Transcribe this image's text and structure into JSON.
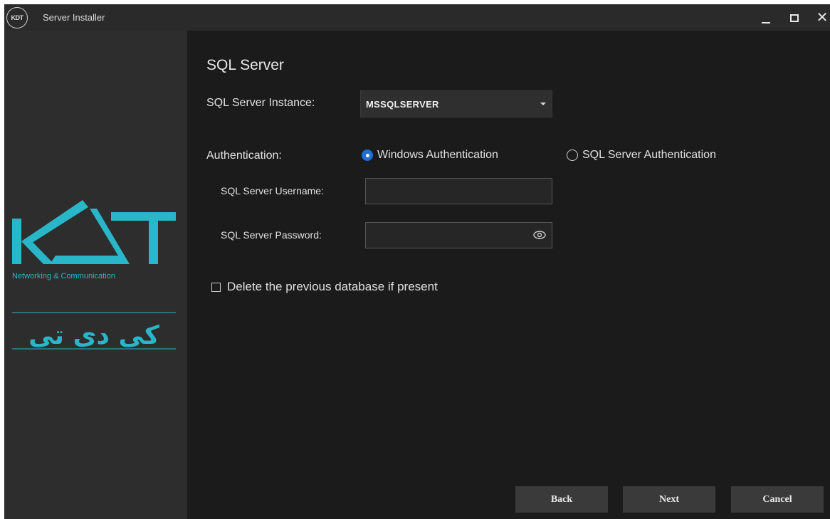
{
  "window": {
    "title": "Server Installer",
    "logo_text": "KDT"
  },
  "sidebar": {
    "brand": "KDT",
    "tagline": "Networking & Communication",
    "brand_farsi": "کی دی تی",
    "accent": "#29b6c8"
  },
  "main": {
    "section_title": "SQL Server",
    "instance": {
      "label": "SQL Server Instance:",
      "value": "MSSQLSERVER"
    },
    "authentication": {
      "label": "Authentication:",
      "options": [
        {
          "label": "Windows Authentication",
          "selected": true
        },
        {
          "label": "SQL Server Authentication",
          "selected": false
        }
      ]
    },
    "username": {
      "label": "SQL Server Username:",
      "value": ""
    },
    "password": {
      "label": "SQL Server Password:",
      "value": ""
    },
    "delete_checkbox": {
      "label": "Delete the previous database if present",
      "checked": false
    }
  },
  "footer": {
    "back_label": "Back",
    "next_label": "Next",
    "cancel_label": "Cancel"
  },
  "icons": {
    "window_controls": [
      "minimize-icon",
      "maximize-icon",
      "close-icon"
    ],
    "password_toggle": "eye-icon"
  }
}
